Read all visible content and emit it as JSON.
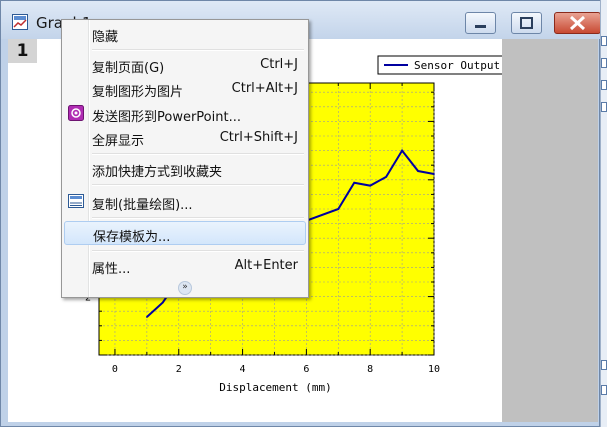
{
  "window": {
    "title": "Graph1"
  },
  "layer_tab": "1",
  "menu": {
    "items": [
      {
        "label": "隐藏",
        "shortcut": ""
      },
      {
        "label": "复制页面(G)",
        "shortcut": "Ctrl+J"
      },
      {
        "label": "复制图形为图片",
        "shortcut": "Ctrl+Alt+J"
      },
      {
        "label": "发送图形到PowerPoint...",
        "shortcut": ""
      },
      {
        "label": "全屏显示",
        "shortcut": "Ctrl+Shift+J"
      },
      {
        "label": "添加快捷方式到收藏夹",
        "shortcut": ""
      },
      {
        "label": "复制(批量绘图)...",
        "shortcut": ""
      },
      {
        "label": "保存模板为...",
        "shortcut": ""
      },
      {
        "label": "属性...",
        "shortcut": "Alt+Enter"
      }
    ],
    "more_glyph": "»"
  },
  "chart_data": {
    "type": "line",
    "xlabel": "Displacement (mm)",
    "x_ticks": [
      "0",
      "2",
      "4",
      "6",
      "8",
      "10"
    ],
    "y_ticks_visible": [
      "2"
    ],
    "xlim": [
      -0.5,
      10
    ],
    "plot_background": "#ffff00",
    "grid": true,
    "legend": {
      "placement": "top-right",
      "entries": [
        "Sensor Output"
      ]
    },
    "series": [
      {
        "name": "Sensor Output",
        "color": "#0000a0",
        "x": [
          1,
          1.5,
          2,
          3,
          4,
          5,
          6,
          7,
          7.5,
          8,
          8.5,
          9,
          9.5,
          10
        ],
        "y": [
          1.3,
          1.8,
          2.6,
          3.1,
          3.6,
          4.1,
          4.6,
          5.0,
          5.9,
          5.8,
          6.1,
          7.0,
          6.3,
          6.2
        ]
      }
    ]
  }
}
